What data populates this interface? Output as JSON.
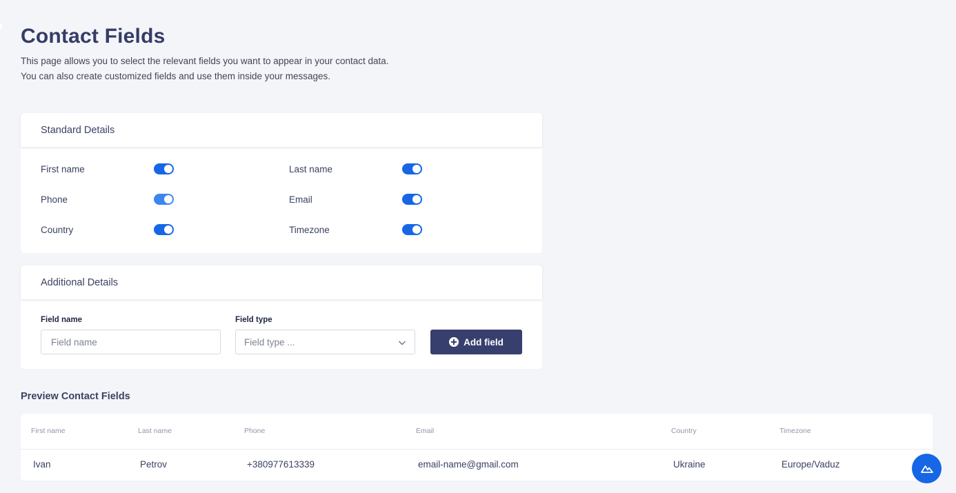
{
  "page": {
    "title": "Contact Fields",
    "description_line1": "This page allows you to select the relevant fields you want to appear in your contact data.",
    "description_line2": "You can also create customized fields and use them inside your messages."
  },
  "standard": {
    "title": "Standard Details",
    "fields": [
      {
        "label": "First name",
        "enabled": true
      },
      {
        "label": "Last name",
        "enabled": true
      },
      {
        "label": "Phone",
        "enabled": true
      },
      {
        "label": "Email",
        "enabled": true
      },
      {
        "label": "Country",
        "enabled": true
      },
      {
        "label": "Timezone",
        "enabled": true
      }
    ]
  },
  "additional": {
    "title": "Additional Details",
    "field_name_label": "Field name",
    "field_name_placeholder": "Field name",
    "field_type_label": "Field type",
    "field_type_placeholder": "Field type ...",
    "add_button_label": "Add field"
  },
  "preview": {
    "title": "Preview Contact Fields",
    "columns": [
      "First name",
      "Last name",
      "Phone",
      "Email",
      "Country",
      "Timezone"
    ],
    "rows": [
      [
        "Ivan",
        "Petrov",
        "+380977613339",
        "email-name@gmail.com",
        "Ukraine",
        "Europe/Vaduz"
      ]
    ]
  },
  "icons": {
    "plus": "plus-circle-icon",
    "chevron": "chevron-down-icon",
    "fab": "mountain-logo-icon"
  },
  "colors": {
    "toggle_on": "#1666e6",
    "button_dark": "#363f6d",
    "background": "#f4f5f9"
  }
}
